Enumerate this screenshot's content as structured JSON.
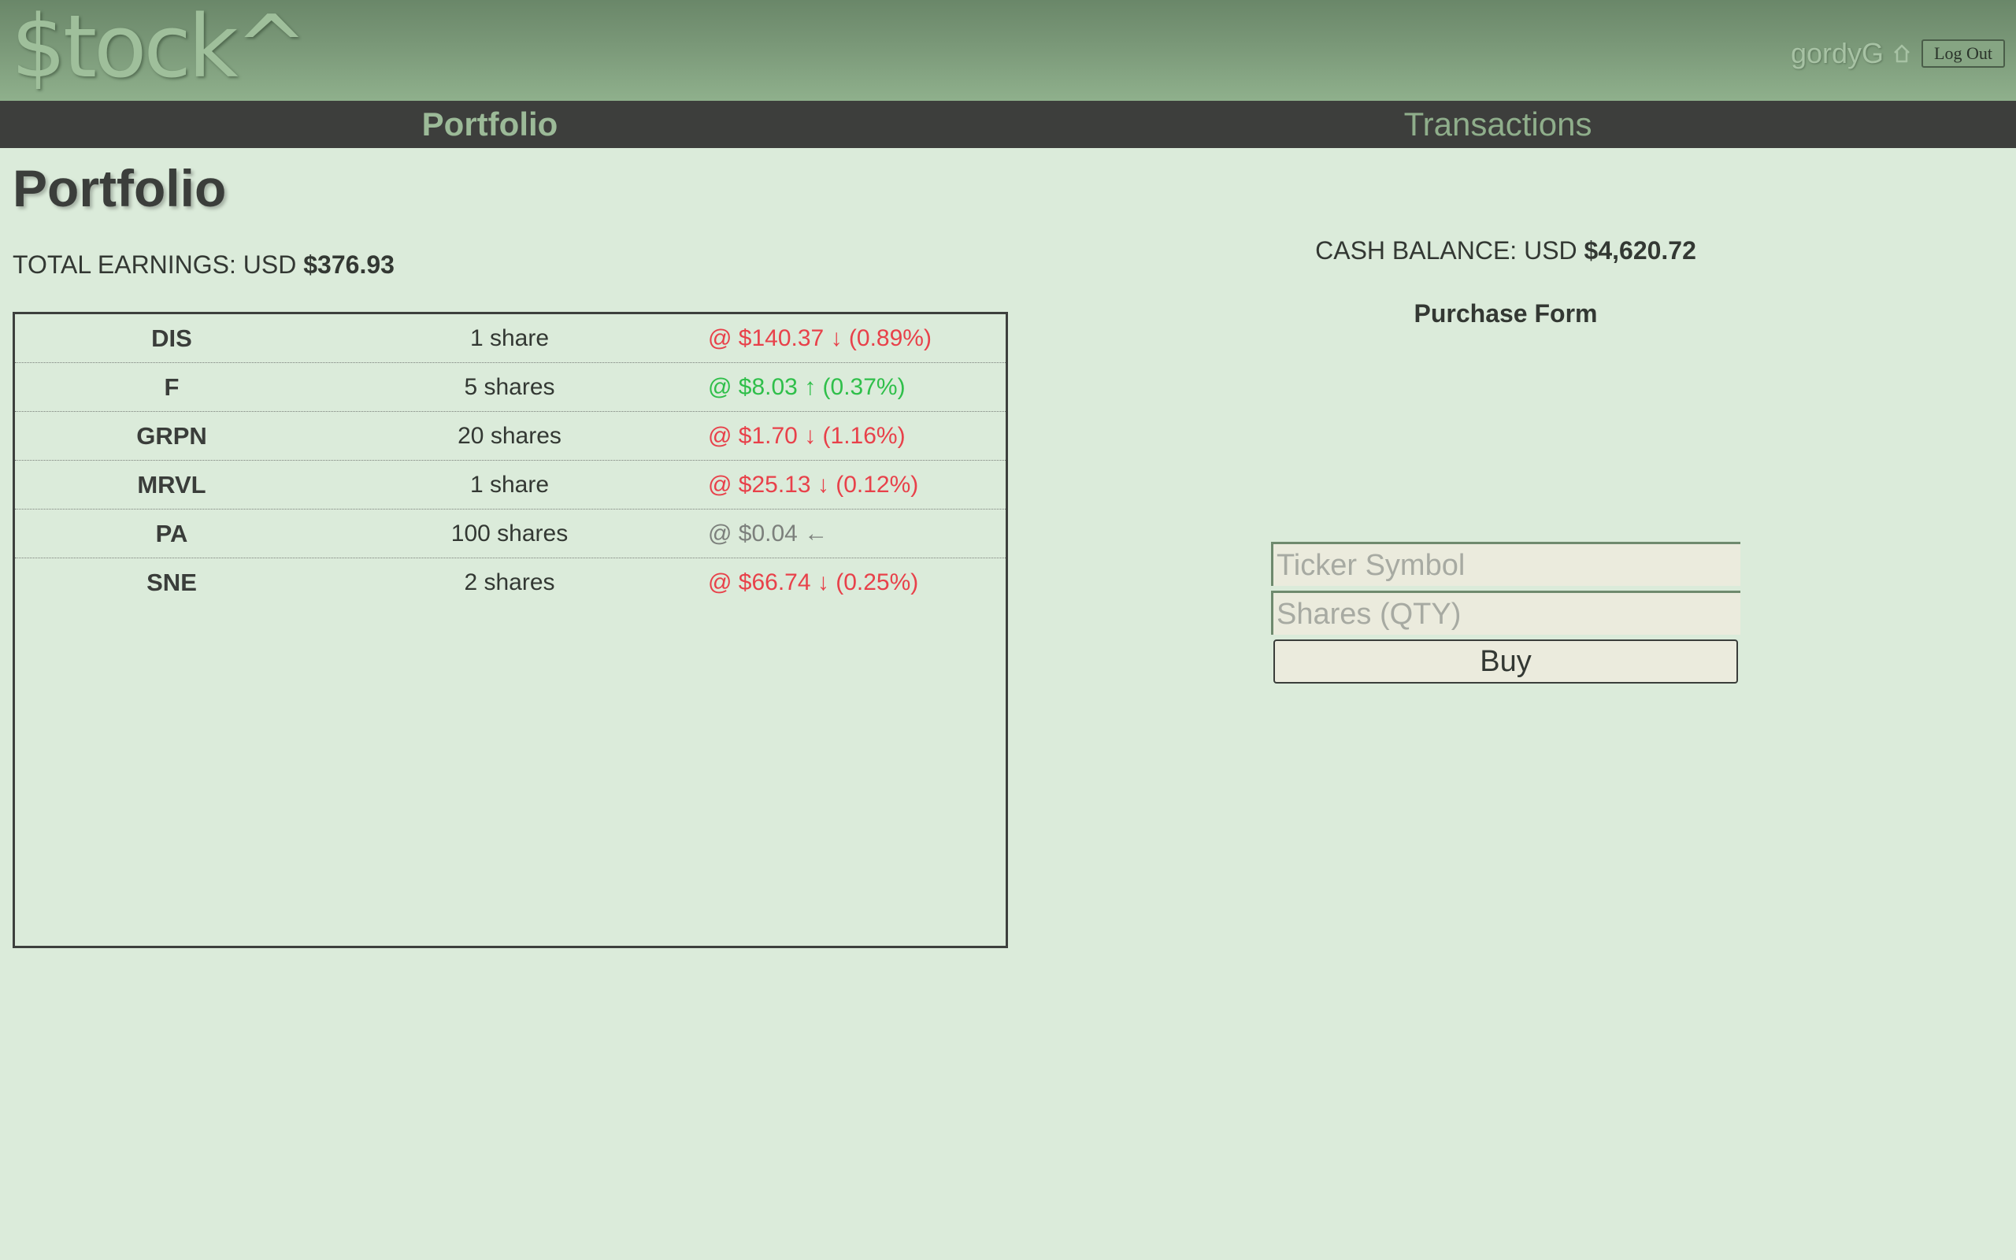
{
  "header": {
    "logo": "$tock^",
    "username": "gordyG",
    "home_icon": "home-icon",
    "logout_label": "Log Out"
  },
  "nav": {
    "tabs": [
      {
        "label": "Portfolio",
        "active": true
      },
      {
        "label": "Transactions",
        "active": false
      }
    ]
  },
  "main": {
    "title": "Portfolio",
    "earnings_label": "TOTAL EARNINGS: USD ",
    "earnings_value": "$376.93",
    "holdings": [
      {
        "ticker": "DIS",
        "shares": "1 share",
        "price": "@ $140.37 ↓ (0.89%)",
        "trend": "down"
      },
      {
        "ticker": "F",
        "shares": "5 shares",
        "price": "@ $8.03 ↑ (0.37%)",
        "trend": "up"
      },
      {
        "ticker": "GRPN",
        "shares": "20 shares",
        "price": "@ $1.70 ↓ (1.16%)",
        "trend": "down"
      },
      {
        "ticker": "MRVL",
        "shares": "1 share",
        "price": "@ $25.13 ↓ (0.12%)",
        "trend": "down"
      },
      {
        "ticker": "PA",
        "shares": "100 shares",
        "price": "@ $0.04 ←",
        "trend": "flat"
      },
      {
        "ticker": "SNE",
        "shares": "2 shares",
        "price": "@ $66.74 ↓ (0.25%)",
        "trend": "down"
      }
    ]
  },
  "purchase": {
    "cash_label": "CASH BALANCE: USD ",
    "cash_value": "$4,620.72",
    "form_title": "Purchase Form",
    "ticker_placeholder": "Ticker Symbol",
    "shares_placeholder": "Shares (QTY)",
    "buy_label": "Buy"
  },
  "colors": {
    "background": "#dbebda",
    "header": "#7a9878",
    "nav": "#3d3e3c",
    "down": "#e8414a",
    "up": "#2fbf4a",
    "flat": "#7c807c"
  }
}
